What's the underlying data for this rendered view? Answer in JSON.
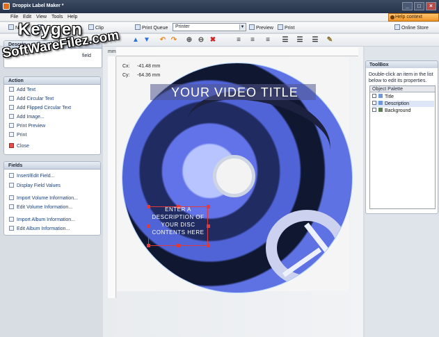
{
  "window": {
    "title": "Droppix Label Maker *",
    "minimize_icon": "minimize-icon",
    "maximize_icon": "maximize-icon",
    "close_icon": "close-icon"
  },
  "menu": {
    "items": [
      "File",
      "Edit",
      "View",
      "Tools",
      "Help"
    ],
    "help_context": "Help context"
  },
  "toolbar": {
    "new": "New",
    "clip_partial": "Clip",
    "print_queue": "Print Queue",
    "printer_value": "Printer",
    "preview": "Preview",
    "print": "Print",
    "online_store": "Online Store"
  },
  "left_panel": {
    "description": {
      "title": "Descrip",
      "text_start": "Use",
      "text_end": "field"
    },
    "actions": {
      "title": "Action",
      "items": [
        "Add Text",
        "Add Circular Text",
        "Add Flipped Circular Text",
        "Add Image...",
        "Print Preview",
        "Print",
        "Close"
      ]
    },
    "fields": {
      "title": "Fields",
      "items": [
        "Insert/Edit Field...",
        "Display Field Values",
        "Import Volume Information...",
        "Edit Volume Information...",
        "Import Album Information...",
        "Edit Album Information..."
      ]
    }
  },
  "workspace": {
    "cx": "Cx:",
    "cx_value": "-41.48 mm",
    "cy": "Cy:",
    "cy_value": "-64.36 mm",
    "ruler_unit": "mm"
  },
  "label": {
    "title": "YOUR VIDEO TITLE",
    "description": "ENTER A DESCRIPTION OF YOUR DISC CONTENTS HERE"
  },
  "toolbox": {
    "title": "ToolBox",
    "hint": "Double-click an item in the list below to edit its properties.",
    "palette_title": "Object Palette",
    "items": [
      "Title",
      "Description",
      "Background"
    ]
  },
  "watermark": {
    "line1": "Keygen",
    "line2": "SoftWareFilez.com"
  },
  "colors": {
    "title_bar": "#2f3d55",
    "accent": "#f59b2a",
    "disc_blue": "#5064d8"
  }
}
